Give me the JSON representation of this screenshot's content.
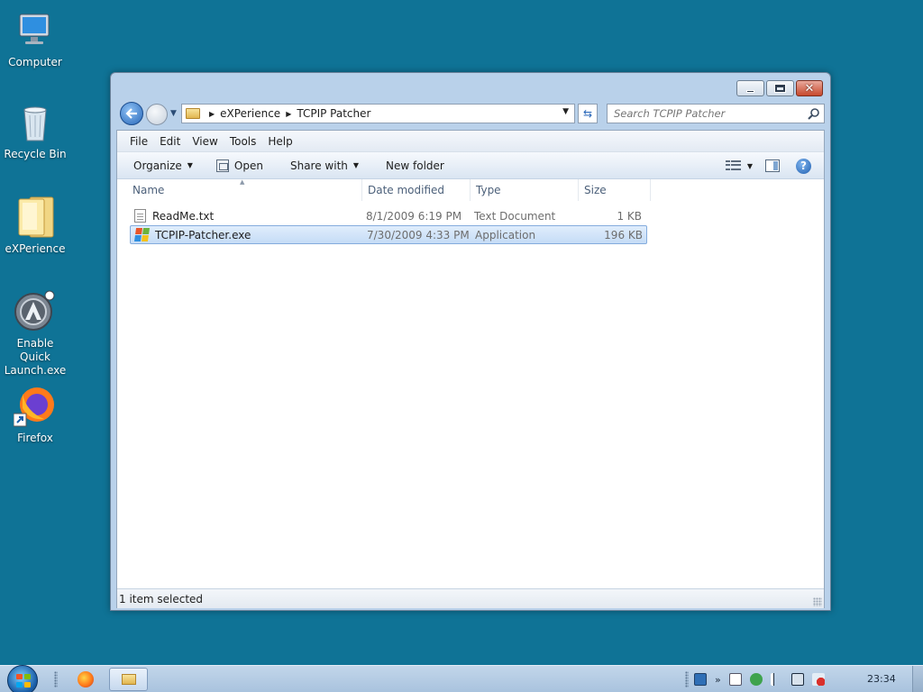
{
  "desktop": {
    "icons": [
      {
        "label": "Computer"
      },
      {
        "label": "Recycle Bin"
      },
      {
        "label": "eXPerience"
      },
      {
        "label": "Enable Quick Launch.exe"
      },
      {
        "label": "Firefox"
      }
    ]
  },
  "window": {
    "breadcrumb": [
      "eXPerience",
      "TCPIP Patcher"
    ],
    "search_placeholder": "Search TCPIP Patcher",
    "menu": [
      "File",
      "Edit",
      "View",
      "Tools",
      "Help"
    ],
    "toolbar": {
      "organize": "Organize",
      "open": "Open",
      "share_with": "Share with",
      "new_folder": "New folder"
    },
    "columns": {
      "name": "Name",
      "date": "Date modified",
      "type": "Type",
      "size": "Size"
    },
    "files": [
      {
        "name": "ReadMe.txt",
        "date": "8/1/2009 6:19 PM",
        "type": "Text Document",
        "size": "1 KB",
        "selected": false
      },
      {
        "name": "TCPIP-Patcher.exe",
        "date": "7/30/2009 4:33 PM",
        "type": "Application",
        "size": "196 KB",
        "selected": true
      }
    ],
    "status": "1 item selected"
  },
  "taskbar": {
    "clock": "23:34"
  },
  "colors": {
    "desktop": "#0f7396",
    "selection": "#c5dcf6"
  }
}
